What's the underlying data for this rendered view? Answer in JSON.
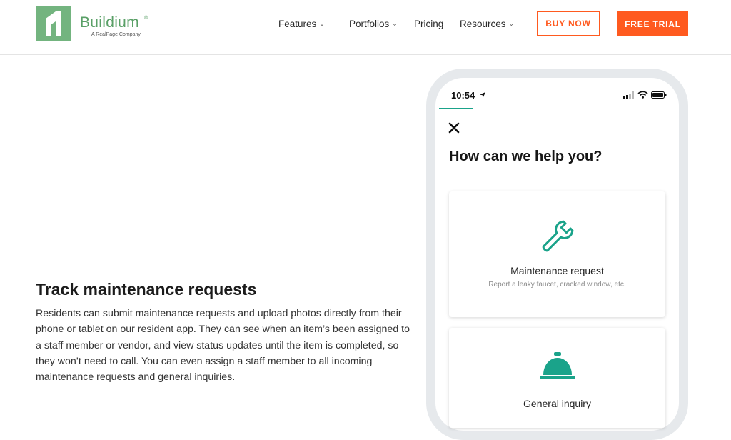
{
  "header": {
    "brand_name": "Buildium",
    "brand_reg": "®",
    "brand_tagline": "A RealPage Company",
    "nav": [
      {
        "label": "Features",
        "has_dropdown": true
      },
      {
        "label": "Portfolios",
        "has_dropdown": true
      },
      {
        "label": "Pricing",
        "has_dropdown": false
      },
      {
        "label": "Resources",
        "has_dropdown": true
      }
    ],
    "dropdown_glyph": "⌄",
    "buy_now": "BUY NOW",
    "free_trial": "FREE TRIAL"
  },
  "feature": {
    "heading": "Track maintenance requests",
    "body": "Residents can submit maintenance requests and upload photos directly from their phone or tablet on our resident app. They can see when an item’s been assigned to a staff member or vendor, and view status updates until the item is completed, so they won’t need to call. You can even assign a staff member to all incoming maintenance requests and general inquiries."
  },
  "phone": {
    "time": "10:54",
    "title": "How can we help you?",
    "cards": [
      {
        "icon": "wrench-icon",
        "label": "Maintenance request",
        "sub": "Report a leaky faucet, cracked window, etc."
      },
      {
        "icon": "service-bell-icon",
        "label": "General inquiry"
      }
    ]
  },
  "colors": {
    "brand_green": "#73b47f",
    "accent_orange": "#ff5a1f",
    "teal": "#1aa38a"
  }
}
